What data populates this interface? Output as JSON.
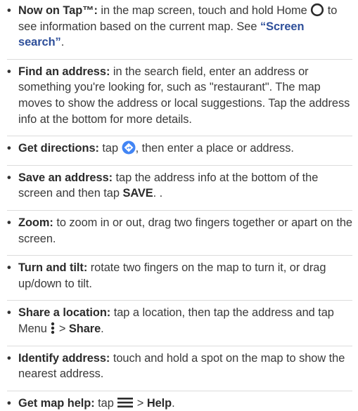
{
  "tips": [
    {
      "lead": "Now on Tap™:",
      "text_a": " in the map screen, touch and hold Home ",
      "icon": "home-circle-icon",
      "text_b": " to see information based on the current map. See ",
      "link": "“Screen search”",
      "text_c": "."
    },
    {
      "lead": "Find an address:",
      "text": " in the search field, enter an address or something you're looking for, such as \"restaurant\". The map moves to show the address or local suggestions. Tap the address info at the bottom for more details."
    },
    {
      "lead": "Get directions:",
      "text_a": " tap ",
      "icon": "directions-icon",
      "text_b": ", then enter a place or address."
    },
    {
      "lead": "Save an address:",
      "text_a": " tap the address info at the bottom of the screen and then tap ",
      "strong": "SAVE",
      "text_b": ". ."
    },
    {
      "lead": "Zoom:",
      "text": " to zoom in or out, drag two fingers together or apart on the screen."
    },
    {
      "lead": "Turn and tilt:",
      "text": " rotate two fingers on the map to turn it, or drag up/down to tilt."
    },
    {
      "lead": "Share a location:",
      "text_a": " tap a location, then tap the address and tap Menu ",
      "icon": "menu-dots-icon",
      "text_b": " > ",
      "strong": "Share",
      "text_c": "."
    },
    {
      "lead": "Identify address:",
      "text": " touch and hold a spot on the map to show the nearest address."
    },
    {
      "lead": "Get map help:",
      "text_a": " tap ",
      "icon": "hamburger-menu-icon",
      "text_b": " > ",
      "strong": "Help",
      "text_c": "."
    }
  ],
  "bullet_char": "•",
  "colors": {
    "text": "#3a3a3a",
    "link": "#2e4f9a",
    "directions_icon": "#4285f4",
    "divider": "#dcdcdc"
  }
}
